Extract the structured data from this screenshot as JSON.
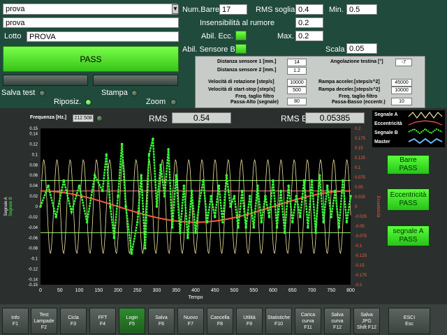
{
  "product": {
    "selected": "prova",
    "name": "prova"
  },
  "lotto": {
    "label": "Lotto",
    "value": "PROVA"
  },
  "status_button": "PASS",
  "leds": {
    "salva_test": "Salva test",
    "stampa": "Stampa",
    "riposiz": "Riposiz.",
    "zoom": "Zoom"
  },
  "params": {
    "num_barre_label": "Num.Barre",
    "num_barre": "17",
    "rms_soglia_label": "RMS soglia",
    "rms_soglia": "0.4",
    "min_label": "Min.",
    "min": "0.5",
    "insens_label": "Insensibilità al rumore",
    "insens": "0.2",
    "abil_ecc_label": "Abil. Ecc.",
    "max_label": "Max.",
    "max": "0.2",
    "abil_sensore_b_label": "Abil. Sensore B",
    "scala_label": "Scala",
    "scala": "0.05"
  },
  "settings": {
    "dist1_label": "Distanza sensore 1 [mm.]",
    "dist1": "14",
    "dist2_label": "Distanza sensore 2 [mm.]",
    "dist2": "1.2",
    "angolo_label": "Angolazione testina [°]",
    "angolo": "-7",
    "vel_rot_label": "Velocità di rotazione [step/s]",
    "vel_rot": "10000",
    "vel_ss_label": "Velocità di start-stop [step/s]",
    "vel_ss": "500",
    "rampa_acc_label": "Rampa acceler.[steps/s^2]",
    "rampa_acc": "45000",
    "rampa_dec_label": "Rampa deceler.[steps/s^2]",
    "rampa_dec": "10000",
    "pa_label1": "Freq. taglio filtro",
    "pa_label2": "Passa-Alto (segnale)",
    "pa": "80",
    "pb_label1": "Freq. taglio filtro",
    "pb_label2": "Passa-Basso (eccentr.)",
    "pb": "10"
  },
  "readouts": {
    "freq_label": "Frequenza",
    "freq_unit": "[Hz.]",
    "freq": "212.508",
    "rms_label": "RMS",
    "rms": "0.54",
    "rmsb_label": "RMS B",
    "rmsb": "0.05385"
  },
  "legend": [
    "Segnale A",
    "Eccentricità",
    "Segnale B",
    "Master"
  ],
  "side_buttons": [
    {
      "l1": "Barre",
      "l2": "PASS"
    },
    {
      "l1": "Eccentricità",
      "l2": "PASS"
    },
    {
      "l1": "segnale A",
      "l2": "PASS"
    }
  ],
  "fkeys": [
    "Info\nF1",
    "Test\nLampade\nF2",
    "Cicla\nF3",
    "FFT\nF4",
    "Login\nF5",
    "Salva\nF6",
    "Nuovo\nF7",
    "Cancella\nF8",
    "Utilità\nF9",
    "Statistiche\nF10",
    "Carica\ncurva\nF11",
    "Salva\ncurva\nF12",
    "Salva\nJPG\nShift F12",
    "ESCI\nEsc"
  ],
  "chart_data": {
    "type": "line",
    "xlabel": "Tempo",
    "ylabel_left": "Segnale A",
    "ylabel_left2": "Segnale B",
    "ylabel_right": "Eccentricità",
    "xlim": [
      0,
      800
    ],
    "ylim_left": [
      -0.15,
      0.15
    ],
    "ylim_right": [
      -0.2,
      0.2
    ],
    "x_ticks": [
      0,
      50,
      100,
      150,
      200,
      250,
      300,
      350,
      400,
      450,
      500,
      550,
      600,
      650,
      700,
      750,
      800
    ],
    "y_ticks_left": [
      "0.15",
      "0.14",
      "0.12",
      "0.1",
      "0.08",
      "0.06",
      "0.04",
      "0.02",
      "0",
      "-0.02",
      "-0.04",
      "-0.06",
      "-0.08",
      "-0.1",
      "-0.12",
      "-0.14",
      "-0.15"
    ],
    "y_ticks_right": [
      "0.2",
      "0.175",
      "0.15",
      "0.125",
      "0.1",
      "0.075",
      "0.05",
      "0.025",
      "0",
      "-0.025",
      "-0.05",
      "-0.075",
      "-0.1",
      "-0.125",
      "-0.15",
      "-0.175",
      "-0.2"
    ],
    "thresholds": [
      0.05,
      -0.05,
      0.03
    ],
    "colors": {
      "segnale_a": "#f2e6a0",
      "eccentricita": "#ff5a3a",
      "segnale_b": "#38ff38",
      "master": "#6ab8ff"
    },
    "series": [
      {
        "name": "Segnale A",
        "type": "sine",
        "amplitude": 0.09,
        "period": 34
      },
      {
        "name": "Eccentricità",
        "type": "sine",
        "amplitude": 0.03,
        "period": 800
      },
      {
        "name": "Segnale B",
        "points": [
          [
            0,
            0
          ],
          [
            20,
            0.04
          ],
          [
            40,
            -0.02
          ],
          [
            60,
            0.05
          ],
          [
            80,
            -0.01
          ],
          [
            100,
            0.04
          ],
          [
            120,
            -0.03
          ],
          [
            140,
            0.06
          ],
          [
            160,
            0.03
          ],
          [
            170,
            0.1
          ],
          [
            180,
            0
          ],
          [
            190,
            -0.06
          ],
          [
            200,
            0.02
          ],
          [
            210,
            0.12
          ],
          [
            220,
            0
          ],
          [
            235,
            -0.09
          ],
          [
            250,
            -0.03
          ],
          [
            260,
            0.06
          ],
          [
            270,
            -0.08
          ],
          [
            280,
            0.1
          ],
          [
            290,
            0.13
          ],
          [
            300,
            0
          ],
          [
            310,
            0.08
          ],
          [
            320,
            0.02
          ],
          [
            330,
            0.11
          ],
          [
            340,
            -0.04
          ],
          [
            350,
            0.06
          ],
          [
            360,
            -0.05
          ],
          [
            370,
            0.04
          ],
          [
            380,
            -0.06
          ],
          [
            390,
            0.03
          ],
          [
            400,
            -0.05
          ],
          [
            410,
            0.01
          ],
          [
            420,
            0.05
          ],
          [
            430,
            -0.03
          ],
          [
            440,
            0.02
          ],
          [
            450,
            -0.02
          ],
          [
            460,
            0.04
          ],
          [
            470,
            -0.03
          ],
          [
            480,
            0.06
          ],
          [
            490,
            0
          ],
          [
            500,
            0.02
          ],
          [
            510,
            -0.04
          ],
          [
            520,
            0.03
          ],
          [
            530,
            -0.04
          ],
          [
            540,
            0.02
          ],
          [
            550,
            -0.04
          ],
          [
            560,
            0.04
          ],
          [
            570,
            -0.03
          ],
          [
            580,
            0.02
          ],
          [
            590,
            -0.02
          ],
          [
            600,
            0.05
          ],
          [
            610,
            -0.04
          ],
          [
            620,
            0.03
          ],
          [
            630,
            -0.05
          ],
          [
            640,
            0.04
          ],
          [
            650,
            -0.03
          ],
          [
            660,
            0.02
          ],
          [
            670,
            -0.02
          ],
          [
            680,
            0.05
          ],
          [
            690,
            -0.04
          ],
          [
            700,
            0.05
          ],
          [
            710,
            -0.05
          ],
          [
            720,
            0.06
          ],
          [
            730,
            -0.03
          ],
          [
            740,
            0.04
          ],
          [
            750,
            -0.02
          ],
          [
            760,
            0.03
          ],
          [
            770,
            -0.04
          ],
          [
            780,
            0.05
          ],
          [
            790,
            -0.03
          ],
          [
            800,
            0.02
          ]
        ]
      }
    ]
  }
}
